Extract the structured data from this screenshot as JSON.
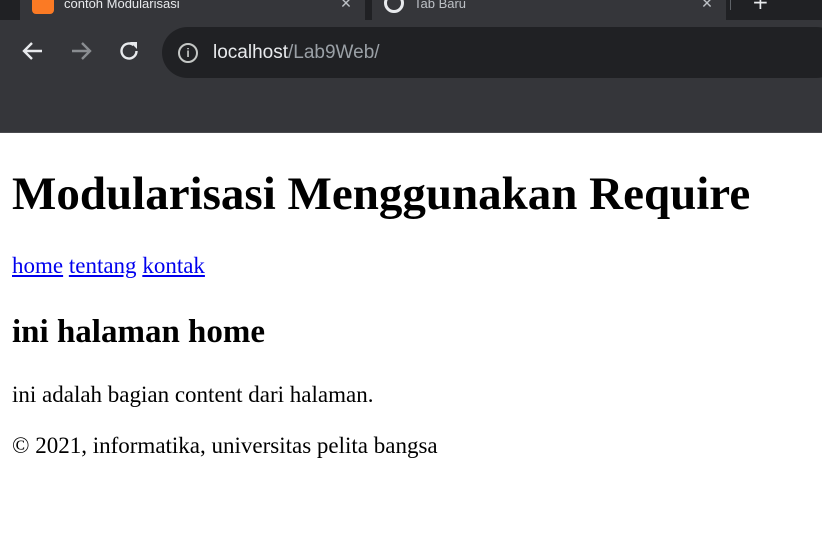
{
  "browser": {
    "tabs": [
      {
        "title": "contoh Modularisasi",
        "favicon": "xampp-icon",
        "active": true
      },
      {
        "title": "Tab Baru",
        "favicon": "globe-icon",
        "active": false
      }
    ],
    "new_tab_label": "+",
    "address": {
      "host": "localhost",
      "path": "/Lab9Web/"
    },
    "colors": {
      "chrome": "#35363a",
      "omnibox": "#202124",
      "text": "#e8eaed"
    }
  },
  "page": {
    "title": "Modularisasi Menggunakan Require",
    "nav": [
      {
        "label": "home"
      },
      {
        "label": "tentang"
      },
      {
        "label": "kontak"
      }
    ],
    "heading": "ini halaman home",
    "content": "ini adalah bagian content dari halaman.",
    "footer": "© 2021, informatika, universitas pelita bangsa",
    "link_color": "#0000ee"
  }
}
